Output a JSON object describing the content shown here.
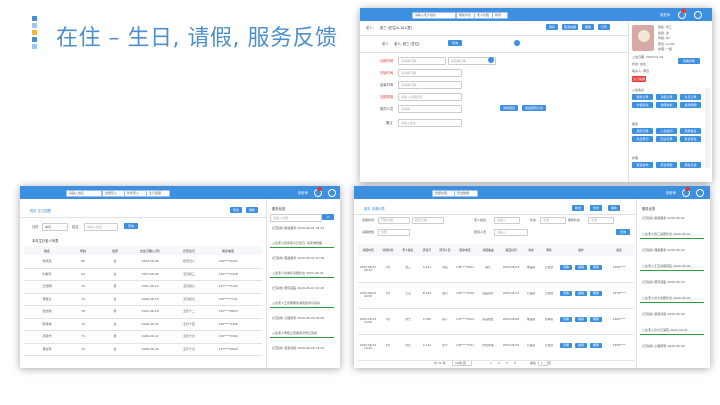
{
  "slide": {
    "title": "在住 – 生日, 请假, 服务反馈",
    "logo_colors": [
      "#4d8fcc",
      "#9ec7ec",
      "#f2b544",
      "#4d8fcc"
    ]
  },
  "colors": {
    "accent": "#3d8fe0",
    "feed_green": "#2e9c3c",
    "required": "#e04040"
  },
  "topbar": {
    "user_name": "张老师",
    "notify_icon": "bell-icon",
    "power_icon": "power-icon"
  },
  "shot1": {
    "toolbar": {
      "search_value": "请输入老人姓名",
      "search_icon": "search-icon",
      "btn_labels": [
        "刷新列表",
        "老人管理",
        "新增"
      ]
    },
    "header": {
      "label1": "老人:",
      "value1": "张三 (在住/A-101/男)",
      "sub": "老人: 张三 (在住)",
      "select_label": "老人",
      "btn": "查询"
    },
    "action_buttons": [
      "保存",
      "取消请假",
      "删除",
      "打印"
    ],
    "form_labels": [
      "请假时间",
      "开始时间",
      "结束时间",
      "请假原因",
      "陪同人员",
      "备注"
    ],
    "form_placeholders": [
      "请选择日期",
      "请选择日期",
      "请选择日期",
      "请输入请假原因",
      "请选择",
      "请输入备注"
    ],
    "form_buttons": [
      "添加陪同",
      "添加陪同人员"
    ],
    "profile": {
      "lines": [
        "姓名: 张三",
        "性别: 女",
        "年龄: 82",
        "床位: A-101",
        "护理: 一级"
      ],
      "extra": [
        "入住日期: 2020-01-01",
        "状态: 在住",
        "联系人: 李四"
      ],
      "red_tag": "生日提醒",
      "btn": "查看详情"
    },
    "side_sections": [
      "入住信息",
      "服务",
      "护理"
    ],
    "side_buttons": [
      "服务记录",
      "请假记录",
      "生日记录",
      "护理评估",
      "健康档案",
      "费用明细",
      "用药记录",
      "入住合同",
      "家属信息",
      "外出登记",
      "回访记录",
      "投诉建议",
      "退住申请",
      "床位调整",
      "服务反馈",
      "更多操作"
    ]
  },
  "shot2": {
    "search_value": "请输入姓名",
    "btn_labels": [
      "批量导入",
      "新增老人",
      "生日提醒"
    ],
    "breadcrumb": "首页  生日提醒",
    "action_buttons": [
      "导出",
      "刷新"
    ],
    "filter": {
      "label1": "月份",
      "value1": "本月",
      "label2": "姓名",
      "placeholder2": "请输入姓名",
      "btn": "查询"
    },
    "table_title": "本月生日老人列表",
    "columns": [
      "姓名",
      "年龄",
      "性别",
      "出生日期(公历)",
      "农历生日",
      "联系电话"
    ],
    "rows": [
      [
        "张凤英",
        "86",
        "女",
        "1934-06-05",
        "四月廿八",
        "138****6201"
      ],
      [
        "刘素珍",
        "83",
        "女",
        "1937-06-09",
        "五月初三",
        "139****2218"
      ],
      [
        "王德明",
        "79",
        "男",
        "1941-06-12",
        "五月初六",
        "137****5102"
      ],
      [
        "李桂兰",
        "74",
        "女",
        "1946-06-15",
        "五月初九",
        "136****7741"
      ],
      [
        "赵志刚",
        "78",
        "男",
        "1942-06-18",
        "五月十二",
        "135****8823"
      ],
      [
        "陈秀梅",
        "74",
        "女",
        "1946-06-20",
        "五月十四",
        "138****4456"
      ],
      [
        "周建华",
        "74",
        "男",
        "1946-06-22",
        "五月十六",
        "139****3309"
      ],
      [
        "吴淑芬",
        "74",
        "女",
        "1946-06-25",
        "五月十九",
        "137****6620"
      ]
    ],
    "feed_title": "服务反馈",
    "feed_placeholder": "请输入内容",
    "feed_items": [
      "[已完成] 助浴服务 2020-06-01 09:15",
      "入住老人张凤英今日生日, 请安排祝福",
      "[已完成] 理发服务 2020-06-02 10:30",
      "入住老人刘素珍请假外出 2020-06-03",
      "[已完成] 陪同就医 2020-06-04 14:20",
      "入住老人王德明服务满意度评价良好",
      "[已完成] 心理疏导 2020-06-05 09:40",
      "入住老人李桂兰家属来访登记完成",
      "[已完成] 康复训练 2020-06-06 15:10"
    ]
  },
  "shot3": {
    "btn_labels": [
      "批量处理",
      "导出数据"
    ],
    "breadcrumb": "首页  请假列表",
    "action_buttons": [
      "新增",
      "导出",
      "刷新"
    ],
    "filters": [
      "请假时间",
      "开始日期",
      "结束日期",
      "老人姓名",
      "请输入",
      "状态",
      "全部",
      "审核状态",
      "全部",
      "请假类型",
      "全部",
      "陪同人员",
      "请输入"
    ],
    "filter_btn": "查询",
    "columns": [
      "请假时间",
      "请假时长",
      "老人姓名",
      "床位号",
      "陪同人员",
      "联系电话",
      "请假事由",
      "返回时间",
      "状态",
      "审核",
      "操作",
      "备注"
    ],
    "rows": [
      [
        "2020-06-01 08:30",
        "2天",
        "张三",
        "A-101",
        "李四",
        "138****6201",
        "探亲",
        "2020-06-03",
        "未返院",
        "已通过",
        "",
        "1390****"
      ],
      [
        "2020-06-02 09:00",
        "1天",
        "王五",
        "B-203",
        "赵六",
        "139****2218",
        "就医复查",
        "2020-06-03",
        "已返院",
        "已通过",
        "",
        "1370****"
      ],
      [
        "2020-06-03 14:00",
        "3天",
        "刘七",
        "C-305",
        "陈八",
        "137****5102",
        "家庭聚会",
        "2020-06-06",
        "未返院",
        "待审核",
        "",
        "1360****"
      ],
      [
        "2020-06-04 10:20",
        "1天",
        "孙九",
        "A-112",
        "周十",
        "136****7741",
        "外出办事",
        "2020-06-05",
        "已返院",
        "已通过",
        "",
        "1350****"
      ]
    ],
    "row_buttons": [
      "查看",
      "编辑",
      "删除"
    ],
    "pagination": {
      "total": "共 32 条",
      "size": "10条/页",
      "pages": [
        "1",
        "2",
        "3",
        "4"
      ],
      "goto": "前往",
      "goto_val": "1",
      "suffix": "页"
    },
    "feed_title": "服务反馈",
    "feed_items": [
      "[已完成] 助浴服务 2020-06-01",
      "入住老人张三请假外出 2020-06-01",
      "[已完成] 理发服务 2020-06-02",
      "入住老人王五请假就医 2020-06-02",
      "[已完成] 陪同就医 2020-06-03",
      "入住老人刘七请假外出 2020-06-03",
      "[已完成] 康复训练 2020-06-04",
      "入住老人孙九已返院 2020-06-05",
      "[已完成] 心理疏导 2020-06-05"
    ]
  }
}
